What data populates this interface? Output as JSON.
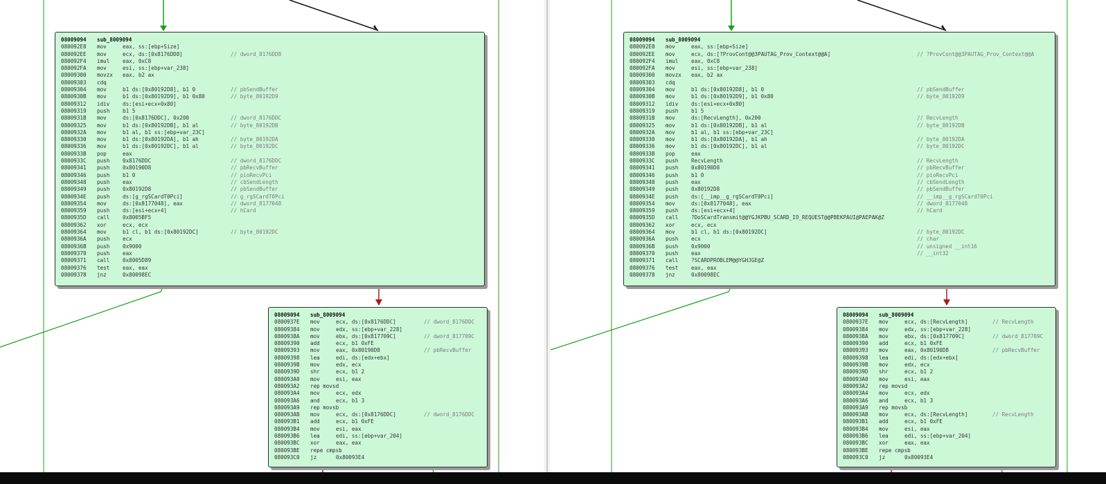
{
  "colors": {
    "block_bg": "#ccf8d8",
    "edge_green": "#19a019",
    "edge_red": "#b01818",
    "edge_black": "#111111"
  },
  "left": {
    "block1": {
      "header": {
        "addr": "08009094",
        "name": "sub_8009094"
      },
      "lines": [
        {
          "a": "080092E8",
          "m": "mov",
          "o": "eax, ss:[ebp+Size]",
          "c": ""
        },
        {
          "a": "080092EE",
          "m": "mov",
          "o": "ecx, ds:[0x8176DD8]",
          "c": "// dword_8176DD8"
        },
        {
          "a": "080092F4",
          "m": "imul",
          "o": "eax, 0xC8",
          "c": ""
        },
        {
          "a": "080092FA",
          "m": "mov",
          "o": "esi, ss:[ebp+var_238]",
          "c": ""
        },
        {
          "a": "08009300",
          "m": "movzx",
          "o": "eax, b2 ax",
          "c": ""
        },
        {
          "a": "08009303",
          "m": "cdq",
          "o": "",
          "c": ""
        },
        {
          "a": "08009304",
          "m": "mov",
          "o": "b1 ds:[0x80192D8], b1 0",
          "c": "// pbSendBuffer"
        },
        {
          "a": "0800930B",
          "m": "mov",
          "o": "b1 ds:[0x80192D9], b1 0x80",
          "c": "// byte_80192D9"
        },
        {
          "a": "08009312",
          "m": "idiv",
          "o": "ds:[esi+ecx+0x80]",
          "c": ""
        },
        {
          "a": "08009319",
          "m": "push",
          "o": "b1 5",
          "c": ""
        },
        {
          "a": "0800931B",
          "m": "mov",
          "o": "ds:[0x8176DDC], 0x200",
          "c": "// dword_8176DDC"
        },
        {
          "a": "08009325",
          "m": "mov",
          "o": "b1 ds:[0x80192DB], b1 al",
          "c": "// byte_80192DB"
        },
        {
          "a": "0800932A",
          "m": "mov",
          "o": "b1 al, b1 ss:[ebp+var_23C]",
          "c": ""
        },
        {
          "a": "08009330",
          "m": "mov",
          "o": "b1 ds:[0x80192DA], b1 ah",
          "c": "// byte_80192DA"
        },
        {
          "a": "08009336",
          "m": "mov",
          "o": "b1 ds:[0x80192DC], b1 al",
          "c": "// byte_80192DC"
        },
        {
          "a": "0800933B",
          "m": "pop",
          "o": "eax",
          "c": ""
        },
        {
          "a": "0800933C",
          "m": "push",
          "o": "0x8176DDC",
          "c": "// dword_8176DDC"
        },
        {
          "a": "08009341",
          "m": "push",
          "o": "0x80190D8",
          "c": "// pbRecvBuffer"
        },
        {
          "a": "08009346",
          "m": "push",
          "o": "b1 0",
          "c": "// pioRecvPci"
        },
        {
          "a": "08009348",
          "m": "push",
          "o": "eax",
          "c": "// cbSendLength"
        },
        {
          "a": "08009349",
          "m": "push",
          "o": "0x80192D8",
          "c": "// pbSendBuffer"
        },
        {
          "a": "0800934E",
          "m": "push",
          "o": "ds:[g_rgSCardT0Pci]",
          "c": "// g_rgSCardT0Pci"
        },
        {
          "a": "08009354",
          "m": "mov",
          "o": "ds:[0x8177048], eax",
          "c": "// dword_8177048"
        },
        {
          "a": "08009359",
          "m": "push",
          "o": "ds:[esi+ecx+4]",
          "c": "// hCard"
        },
        {
          "a": "0800935D",
          "m": "call",
          "o": "0x8005BF5",
          "c": ""
        },
        {
          "a": "08009362",
          "m": "xor",
          "o": "ecx, ecx",
          "c": ""
        },
        {
          "a": "08009364",
          "m": "mov",
          "o": "b1 cl, b1 ds:[0x80192DC]",
          "c": "// byte_80192DC"
        },
        {
          "a": "0800936A",
          "m": "push",
          "o": "ecx",
          "c": ""
        },
        {
          "a": "0800936B",
          "m": "push",
          "o": "0x9000",
          "c": ""
        },
        {
          "a": "08009370",
          "m": "push",
          "o": "eax",
          "c": ""
        },
        {
          "a": "08009371",
          "m": "call",
          "o": "0x8005D89",
          "c": ""
        },
        {
          "a": "08009376",
          "m": "test",
          "o": "eax, eax",
          "c": ""
        },
        {
          "a": "08009378",
          "m": "jnz",
          "o": "0x80098EC",
          "c": ""
        }
      ]
    },
    "block2": {
      "header": {
        "addr": "08009094",
        "name": "sub_8009094"
      },
      "lines": [
        {
          "a": "0800937E",
          "m": "mov",
          "o": "ecx, ds:[0x8176DDC]",
          "c": "// dword_8176DDC"
        },
        {
          "a": "08009384",
          "m": "mov",
          "o": "edx, ss:[ebp+var_228]",
          "c": ""
        },
        {
          "a": "0800938A",
          "m": "mov",
          "o": "ebx, ds:[0x817709C]",
          "c": "// dword_817709C"
        },
        {
          "a": "08009390",
          "m": "add",
          "o": "ecx, b1 0xFE",
          "c": ""
        },
        {
          "a": "08009393",
          "m": "mov",
          "o": "eax, 0x80190D8",
          "c": "// pbRecvBuffer"
        },
        {
          "a": "08009398",
          "m": "lea",
          "o": "edi, ds:[edx+ebx]",
          "c": ""
        },
        {
          "a": "0800939B",
          "m": "mov",
          "o": "edx, ecx",
          "c": ""
        },
        {
          "a": "0800939D",
          "m": "shr",
          "o": "ecx, b1 2",
          "c": ""
        },
        {
          "a": "080093A0",
          "m": "mov",
          "o": "esi, eax",
          "c": ""
        },
        {
          "a": "080093A2",
          "m": "rep movsd",
          "o": "",
          "c": ""
        },
        {
          "a": "080093A4",
          "m": "mov",
          "o": "ecx, edx",
          "c": ""
        },
        {
          "a": "080093A6",
          "m": "and",
          "o": "ecx, b1 3",
          "c": ""
        },
        {
          "a": "080093A9",
          "m": "rep movsb",
          "o": "",
          "c": ""
        },
        {
          "a": "080093AB",
          "m": "mov",
          "o": "ecx, ds:[0x8176DDC]",
          "c": "// dword_8176DDC"
        },
        {
          "a": "080093B1",
          "m": "add",
          "o": "ecx, b1 0xFE",
          "c": ""
        },
        {
          "a": "080093B4",
          "m": "mov",
          "o": "esi, eax",
          "c": ""
        },
        {
          "a": "080093B6",
          "m": "lea",
          "o": "edi, ss:[ebp+var_204]",
          "c": ""
        },
        {
          "a": "080093BC",
          "m": "xor",
          "o": "eax, eax",
          "c": ""
        },
        {
          "a": "080093BE",
          "m": "repe cmpsb",
          "o": "",
          "c": ""
        },
        {
          "a": "080093C0",
          "m": "jz",
          "o": "0x80093E4",
          "c": ""
        }
      ]
    }
  },
  "right": {
    "block1": {
      "header": {
        "addr": "08009094",
        "name": "sub_8009094"
      },
      "lines": [
        {
          "a": "080092E8",
          "m": "mov",
          "o": "eax, ss:[ebp+Size]",
          "c": ""
        },
        {
          "a": "080092EE",
          "m": "mov",
          "o": "ecx, ds:[?ProvCont@@3PAUTAG_Prov_Context@@A]",
          "c": "// ?ProvCont@@3PAUTAG_Prov_Context@@A"
        },
        {
          "a": "080092F4",
          "m": "imul",
          "o": "eax, 0xC8",
          "c": ""
        },
        {
          "a": "080092FA",
          "m": "mov",
          "o": "esi, ss:[ebp+var_238]",
          "c": ""
        },
        {
          "a": "08009300",
          "m": "movzx",
          "o": "eax, b2 ax",
          "c": ""
        },
        {
          "a": "08009303",
          "m": "cdq",
          "o": "",
          "c": ""
        },
        {
          "a": "08009304",
          "m": "mov",
          "o": "b1 ds:[0x80192D8], b1 0",
          "c": "// pbSendBuffer"
        },
        {
          "a": "0800930B",
          "m": "mov",
          "o": "b1 ds:[0x80192D9], b1 0x80",
          "c": "// byte_80192D9"
        },
        {
          "a": "08009312",
          "m": "idiv",
          "o": "ds:[esi+ecx+0x80]",
          "c": ""
        },
        {
          "a": "08009319",
          "m": "push",
          "o": "b1 5",
          "c": ""
        },
        {
          "a": "0800931B",
          "m": "mov",
          "o": "ds:[RecvLength], 0x200",
          "c": "// RecvLength"
        },
        {
          "a": "08009325",
          "m": "mov",
          "o": "b1 ds:[0x80192DB], b1 al",
          "c": "// byte_80192DB"
        },
        {
          "a": "0800932A",
          "m": "mov",
          "o": "b1 al, b1 ss:[ebp+var_23C]",
          "c": ""
        },
        {
          "a": "08009330",
          "m": "mov",
          "o": "b1 ds:[0x80192DA], b1 ah",
          "c": "// byte_80192DA"
        },
        {
          "a": "08009336",
          "m": "mov",
          "o": "b1 ds:[0x80192DC], b1 al",
          "c": "// byte_80192DC"
        },
        {
          "a": "0800933B",
          "m": "pop",
          "o": "eax",
          "c": ""
        },
        {
          "a": "0800933C",
          "m": "push",
          "o": "RecvLength",
          "c": "// RecvLength"
        },
        {
          "a": "08009341",
          "m": "push",
          "o": "0x80190D8",
          "c": "// pbRecvBuffer"
        },
        {
          "a": "08009346",
          "m": "push",
          "o": "b1 0",
          "c": "// pioRecvPci"
        },
        {
          "a": "08009348",
          "m": "push",
          "o": "eax",
          "c": "// cbSendLength"
        },
        {
          "a": "08009349",
          "m": "push",
          "o": "0x80192D8",
          "c": "// pbSendBuffer"
        },
        {
          "a": "0800934E",
          "m": "push",
          "o": "ds:[__imp__g_rgSCardT0Pci]",
          "c": "// __imp__g_rgSCardT0Pci"
        },
        {
          "a": "08009354",
          "m": "mov",
          "o": "ds:[0x8177048], eax",
          "c": "// dword_8177048"
        },
        {
          "a": "08009359",
          "m": "push",
          "o": "ds:[esi+ecx+4]",
          "c": "// hCard"
        },
        {
          "a": "0800935D",
          "m": "call",
          "o": "?DoSCardTransmit@@YGJKPBU_SCARD_IO_REQUEST@@PBEKPAUI@PAEPAK@Z",
          "c": ""
        },
        {
          "a": "08009362",
          "m": "xor",
          "o": "ecx, ecx",
          "c": ""
        },
        {
          "a": "08009364",
          "m": "mov",
          "o": "b1 cl, b1 ds:[0x80192DC]",
          "c": "// byte_80192DC"
        },
        {
          "a": "0800936A",
          "m": "push",
          "o": "ecx",
          "c": "// char"
        },
        {
          "a": "0800936B",
          "m": "push",
          "o": "0x9000",
          "c": "// unsigned __int16"
        },
        {
          "a": "08009370",
          "m": "push",
          "o": "eax",
          "c": "// __int32"
        },
        {
          "a": "08009371",
          "m": "call",
          "o": "?SCARDPROBLEM@@YGHJGE@Z",
          "c": ""
        },
        {
          "a": "08009376",
          "m": "test",
          "o": "eax, eax",
          "c": ""
        },
        {
          "a": "08009378",
          "m": "jnz",
          "o": "0x80098EC",
          "c": ""
        }
      ]
    },
    "block2": {
      "header": {
        "addr": "08009094",
        "name": "sub_8009094"
      },
      "lines": [
        {
          "a": "0800937E",
          "m": "mov",
          "o": "ecx, ds:[RecvLength]",
          "c": "// RecvLength"
        },
        {
          "a": "08009384",
          "m": "mov",
          "o": "edx, ss:[ebp+var_228]",
          "c": ""
        },
        {
          "a": "0800938A",
          "m": "mov",
          "o": "ebx, ds:[0x817709C]",
          "c": "// dword_817709C"
        },
        {
          "a": "08009390",
          "m": "add",
          "o": "ecx, b1 0xFE",
          "c": ""
        },
        {
          "a": "08009393",
          "m": "mov",
          "o": "eax, 0x80190D8",
          "c": "// pbRecvBuffer"
        },
        {
          "a": "08009398",
          "m": "lea",
          "o": "edi, ds:[edx+ebx]",
          "c": ""
        },
        {
          "a": "0800939B",
          "m": "mov",
          "o": "edx, ecx",
          "c": ""
        },
        {
          "a": "0800939D",
          "m": "shr",
          "o": "ecx, b1 2",
          "c": ""
        },
        {
          "a": "080093A0",
          "m": "mov",
          "o": "esi, eax",
          "c": ""
        },
        {
          "a": "080093A2",
          "m": "rep movsd",
          "o": "",
          "c": ""
        },
        {
          "a": "080093A4",
          "m": "mov",
          "o": "ecx, edx",
          "c": ""
        },
        {
          "a": "080093A6",
          "m": "and",
          "o": "ecx, b1 3",
          "c": ""
        },
        {
          "a": "080093A9",
          "m": "rep movsb",
          "o": "",
          "c": ""
        },
        {
          "a": "080093AB",
          "m": "mov",
          "o": "ecx, ds:[RecvLength]",
          "c": "// RecvLength"
        },
        {
          "a": "080093B1",
          "m": "add",
          "o": "ecx, b1 0xFE",
          "c": ""
        },
        {
          "a": "080093B4",
          "m": "mov",
          "o": "esi, eax",
          "c": ""
        },
        {
          "a": "080093B6",
          "m": "lea",
          "o": "edi, ss:[ebp+var_204]",
          "c": ""
        },
        {
          "a": "080093BC",
          "m": "xor",
          "o": "eax, eax",
          "c": ""
        },
        {
          "a": "080093BE",
          "m": "repe cmpsb",
          "o": "",
          "c": ""
        },
        {
          "a": "080093C0",
          "m": "jz",
          "o": "0x80093E4",
          "c": ""
        }
      ]
    }
  }
}
